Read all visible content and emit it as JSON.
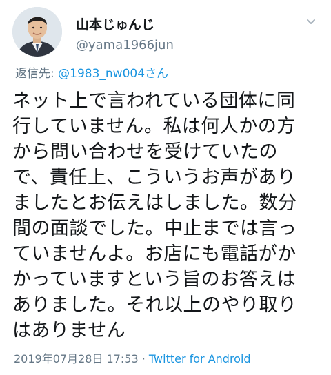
{
  "author": {
    "display_name": "山本じゅんじ",
    "handle": "@yama1966jun"
  },
  "reply": {
    "prefix": "返信先: ",
    "mention": "@1983_nw004さん"
  },
  "tweet": {
    "lines": [
      "ネット上で言われている団体に同",
      "行していません。私は何人かの方",
      "から問い合わせを受けていたの",
      "で、責任上、こういうお声があり",
      "ましたとお伝えはしました。数分",
      "間の面談でした。中止までは言っ",
      "ていませんよ。お店にも電話がか",
      "かっていますという旨のお答えは",
      "ありました。それ以上のやり取り",
      "はありません"
    ]
  },
  "meta": {
    "timestamp": "2019年07月28日 17:53",
    "separator": " · ",
    "source": "Twitter for Android"
  },
  "colors": {
    "text": "#14171a",
    "secondary": "#657786",
    "link": "#1b95e0"
  },
  "icons": {
    "avatar": "avatar",
    "menu": "chevron-down-icon"
  }
}
